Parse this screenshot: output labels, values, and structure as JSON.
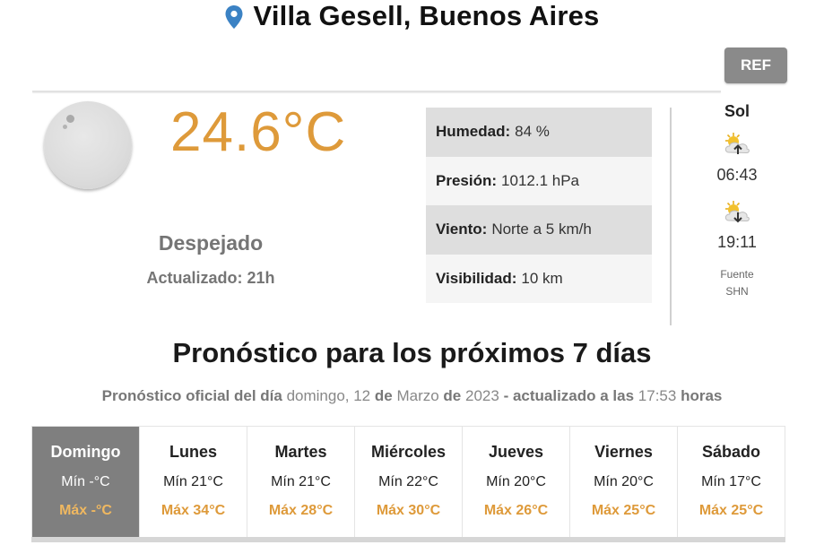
{
  "header": {
    "location": "Villa Gesell, Buenos Aires",
    "ref_label": "REF"
  },
  "current": {
    "temperature": "24.6°C",
    "condition": "Despejado",
    "updated": "Actualizado: 21h",
    "icon": "clear-night-moon-icon"
  },
  "details": [
    {
      "label": "Humedad:",
      "value": "84 %"
    },
    {
      "label": "Presión:",
      "value": "1012.1 hPa"
    },
    {
      "label": "Viento:",
      "value": "Norte a 5 km/h"
    },
    {
      "label": "Visibilidad:",
      "value": "10 km"
    }
  ],
  "sun": {
    "title": "Sol",
    "sunrise": "06:43",
    "sunset": "19:11",
    "source_label": "Fuente",
    "source_name": "SHN"
  },
  "forecast": {
    "heading": "Pronóstico para los próximos 7 días",
    "sub": {
      "part1": "Pronóstico oficial del día",
      "day": "domingo, 12",
      "de1": "de",
      "month": "Marzo",
      "de2": "de",
      "year": "2023",
      "part2": "- actualizado a las",
      "time": "17:53",
      "part3": "horas"
    },
    "days": [
      {
        "name": "Domingo",
        "min": "Mín -°C",
        "max": "Máx -°C",
        "active": true
      },
      {
        "name": "Lunes",
        "min": "Mín 21°C",
        "max": "Máx 34°C"
      },
      {
        "name": "Martes",
        "min": "Mín 21°C",
        "max": "Máx 28°C"
      },
      {
        "name": "Miércoles",
        "min": "Mín 22°C",
        "max": "Máx 30°C"
      },
      {
        "name": "Jueves",
        "min": "Mín 20°C",
        "max": "Máx 26°C"
      },
      {
        "name": "Viernes",
        "min": "Mín 20°C",
        "max": "Máx 25°C"
      },
      {
        "name": "Sábado",
        "min": "Mín 17°C",
        "max": "Máx 25°C"
      }
    ]
  },
  "colors": {
    "accent_orange": "#de9a3a",
    "active_day_bg": "#7f7f7f",
    "pin_blue": "#3b82c4"
  }
}
